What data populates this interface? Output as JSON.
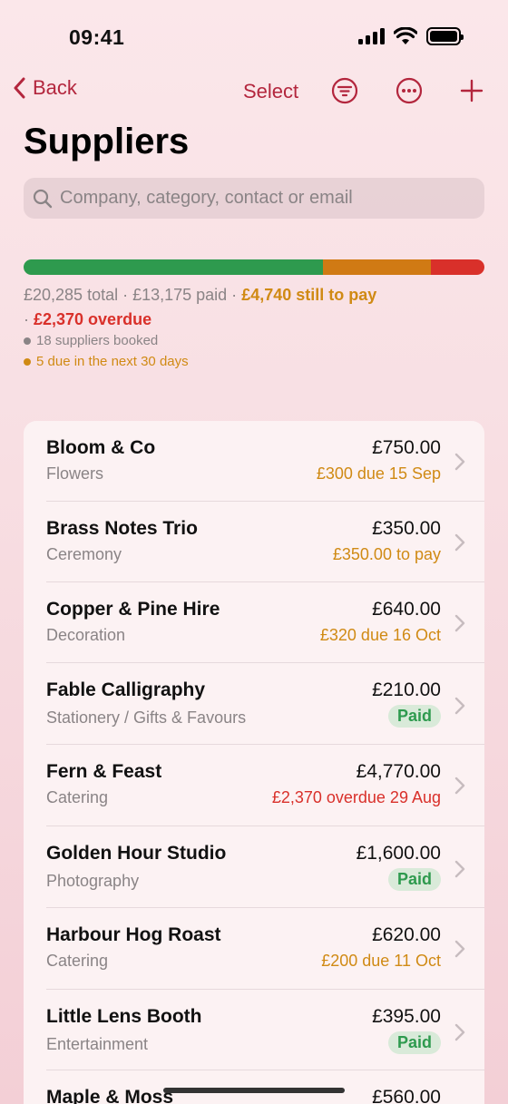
{
  "status_bar": {
    "time": "09:41"
  },
  "nav": {
    "back_label": "Back",
    "select_label": "Select"
  },
  "page": {
    "title": "Suppliers"
  },
  "search": {
    "placeholder": "Company, category, contact or email"
  },
  "summary": {
    "total_text": "£20,285 total · £13,175 paid · ",
    "to_pay_text": "£4,740 still to pay",
    "sep_text": "· ",
    "overdue_text": "£2,370 overdue",
    "booked_text": "18 suppliers booked",
    "due_soon_text": "5 due in the next 30 days",
    "progress": {
      "paid_fraction": 0.65,
      "to_pay_fraction": 0.233,
      "overdue_fraction": 0.117
    }
  },
  "colors": {
    "accent": "#b3263d",
    "paid": "#2e9a4e",
    "to_pay": "#d08a14",
    "overdue": "#d9302a"
  },
  "suppliers": [
    {
      "name": "Bloom & Co",
      "category": "Flowers",
      "amount": "£750.00",
      "status": "£300 due 15 Sep",
      "status_type": "due"
    },
    {
      "name": "Brass Notes Trio",
      "category": "Ceremony",
      "amount": "£350.00",
      "status": "£350.00 to pay",
      "status_type": "due"
    },
    {
      "name": "Copper & Pine Hire",
      "category": "Decoration",
      "amount": "£640.00",
      "status": "£320 due 16 Oct",
      "status_type": "due"
    },
    {
      "name": "Fable Calligraphy",
      "category": "Stationery / Gifts & Favours",
      "amount": "£210.00",
      "status": "Paid",
      "status_type": "paid"
    },
    {
      "name": "Fern & Feast",
      "category": "Catering",
      "amount": "£4,770.00",
      "status": "£2,370 overdue 29 Aug",
      "status_type": "overdue"
    },
    {
      "name": "Golden Hour Studio",
      "category": "Photography",
      "amount": "£1,600.00",
      "status": "Paid",
      "status_type": "paid"
    },
    {
      "name": "Harbour Hog Roast",
      "category": "Catering",
      "amount": "£620.00",
      "status": "£200 due 11 Oct",
      "status_type": "due"
    },
    {
      "name": "Little Lens Booth",
      "category": "Entertainment",
      "amount": "£395.00",
      "status": "Paid",
      "status_type": "paid"
    },
    {
      "name": "Maple & Moss",
      "category": "",
      "amount": "£560.00",
      "status": "",
      "status_type": ""
    }
  ]
}
